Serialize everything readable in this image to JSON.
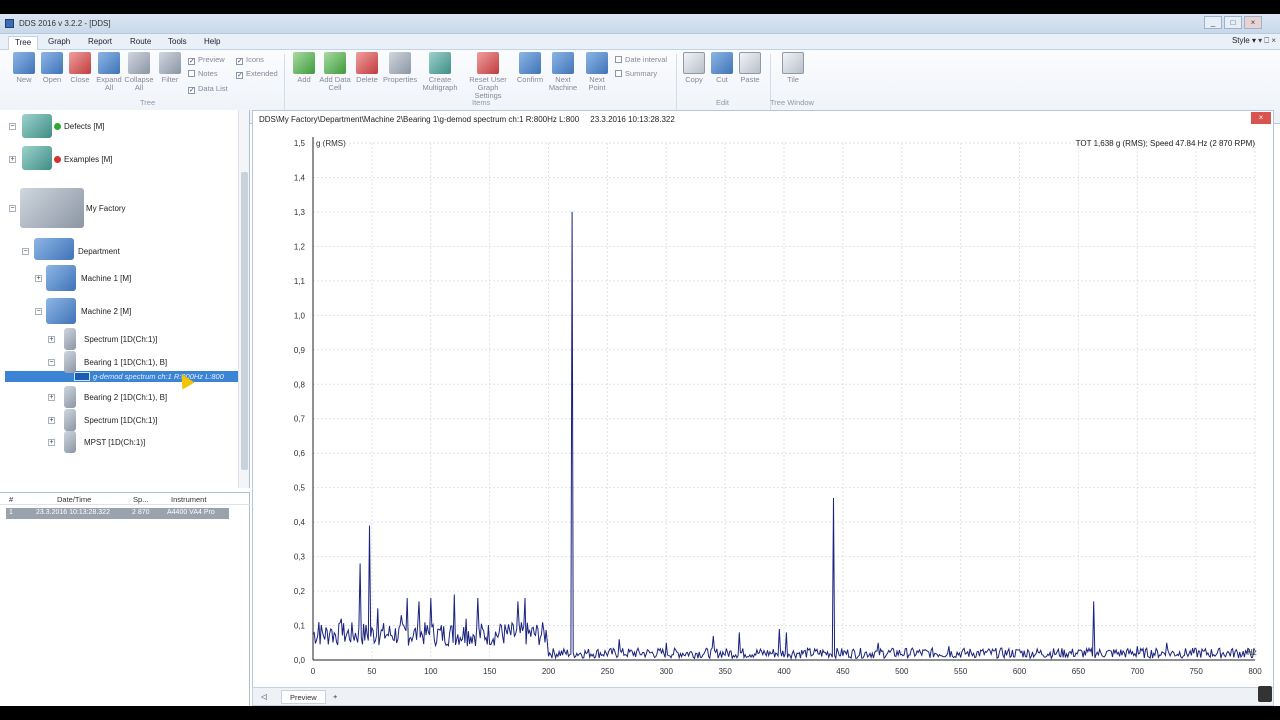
{
  "window": {
    "title": "DDS 2016 v 3.2.2 - [DDS]",
    "controls": [
      "_",
      "□",
      "×"
    ]
  },
  "menu": {
    "tabs": [
      "Tree",
      "Graph",
      "Report",
      "Route",
      "Tools",
      "Help"
    ],
    "active_tab": "Tree",
    "style_label": "Style",
    "ribbon_controls": "▾  ⎕  ×"
  },
  "ribbon": {
    "tree_group": {
      "label": "Tree",
      "buttons": [
        {
          "label": "New",
          "icon": "new-folder-icon"
        },
        {
          "label": "Open",
          "icon": "open-folder-icon"
        },
        {
          "label": "Close",
          "icon": "close-folder-icon"
        },
        {
          "label": "Expand All",
          "icon": "expand-all-icon"
        },
        {
          "label": "Collapse All",
          "icon": "collapse-all-icon"
        },
        {
          "label": "Filter",
          "icon": "filter-icon"
        }
      ],
      "checks": [
        {
          "label": "Preview",
          "checked": true
        },
        {
          "label": "Notes",
          "checked": false
        },
        {
          "label": "Data List",
          "checked": true
        },
        {
          "label": "Icons",
          "checked": true
        },
        {
          "label": "Extended",
          "checked": true
        }
      ]
    },
    "items_group": {
      "label": "Items",
      "buttons": [
        {
          "label": "Add",
          "icon": "add-icon"
        },
        {
          "label": "Add Data Cell",
          "icon": "add-data-cell-icon"
        },
        {
          "label": "Delete",
          "icon": "delete-icon"
        },
        {
          "label": "Properties",
          "icon": "properties-icon"
        },
        {
          "label": "Create Multigraph",
          "icon": "multigraph-icon"
        },
        {
          "label": "Reset User Graph Settings",
          "icon": "reset-settings-icon"
        },
        {
          "label": "Confirm",
          "icon": "confirm-icon"
        },
        {
          "label": "Next Machine",
          "icon": "next-machine-icon"
        },
        {
          "label": "Next Point",
          "icon": "next-point-icon"
        }
      ],
      "checks": [
        {
          "label": "Date interval",
          "checked": false
        },
        {
          "label": "Summary",
          "checked": false
        }
      ]
    },
    "edit_group": {
      "label": "Edit",
      "buttons": [
        {
          "label": "Copy",
          "icon": "copy-icon"
        },
        {
          "label": "Cut",
          "icon": "cut-icon"
        },
        {
          "label": "Paste",
          "icon": "paste-icon"
        }
      ]
    },
    "tree_window_group": {
      "label": "Tree Window",
      "buttons": [
        {
          "label": "Tile",
          "icon": "tile-icon"
        }
      ]
    }
  },
  "tree": {
    "items": [
      {
        "label": "Defects [M]",
        "status": "green"
      },
      {
        "label": "Examples [M]",
        "status": "red"
      },
      {
        "label": "My Factory"
      },
      {
        "label": "Department"
      },
      {
        "label": "Machine 1 [M]"
      },
      {
        "label": "Machine 2 [M]"
      },
      {
        "label": "Spectrum [1D(Ch:1)]"
      },
      {
        "label": "Bearing 1 [1D(Ch:1), B]"
      },
      {
        "label": "g-demod spectrum ch:1 R:800Hz L:800",
        "selected": true
      },
      {
        "label": "Bearing 2 [1D(Ch:1), B]"
      },
      {
        "label": "Spectrum [1D(Ch:1)]"
      },
      {
        "label": "MPST [1D(Ch:1)]"
      }
    ]
  },
  "measurements": {
    "columns": [
      "#",
      "Date/Time",
      "Sp...",
      "Instrument"
    ],
    "rows": [
      {
        "num": "1",
        "datetime": "23.3.2016 10:13:28.322",
        "speed": "2 870",
        "instrument": "A4400 VA4 Pro"
      }
    ]
  },
  "chart_pane": {
    "path": "DDS\\My Factory\\Department\\Machine 2\\Bearing 1\\g-demod spectrum ch:1 R:800Hz L:800",
    "timestamp": "23.3.2016 10:13:28.322",
    "close_label": "×"
  },
  "chart_data": {
    "type": "line",
    "title": "",
    "ylabel": "g (RMS)",
    "xlabel": "Hz",
    "info": "TOT 1,638 g (RMS); Speed 47.84 Hz (2 870 RPM)",
    "xlim": [
      0,
      800
    ],
    "ylim": [
      0,
      1.5
    ],
    "x_ticks": [
      "0",
      "50",
      "100",
      "150",
      "200",
      "250",
      "300",
      "350",
      "400",
      "450",
      "500",
      "550",
      "600",
      "650",
      "700",
      "750",
      "800"
    ],
    "y_ticks": [
      "0,0",
      "0,1",
      "0,2",
      "0,3",
      "0,4",
      "0,5",
      "0,6",
      "0,7",
      "0,8",
      "0,9",
      "1,0",
      "1,1",
      "1,2",
      "1,3",
      "1,4",
      "1,5"
    ],
    "grid": true,
    "series_color": "#1a237e",
    "peaks": [
      {
        "x": 5,
        "y": 0.11
      },
      {
        "x": 15,
        "y": 0.09
      },
      {
        "x": 24,
        "y": 0.12
      },
      {
        "x": 40,
        "y": 0.28
      },
      {
        "x": 48,
        "y": 0.39
      },
      {
        "x": 55,
        "y": 0.15
      },
      {
        "x": 75,
        "y": 0.13
      },
      {
        "x": 80,
        "y": 0.18
      },
      {
        "x": 90,
        "y": 0.17
      },
      {
        "x": 100,
        "y": 0.18
      },
      {
        "x": 120,
        "y": 0.19
      },
      {
        "x": 130,
        "y": 0.12
      },
      {
        "x": 140,
        "y": 0.18
      },
      {
        "x": 160,
        "y": 0.1
      },
      {
        "x": 174,
        "y": 0.17
      },
      {
        "x": 180,
        "y": 0.18
      },
      {
        "x": 220,
        "y": 1.3
      },
      {
        "x": 260,
        "y": 0.06
      },
      {
        "x": 300,
        "y": 0.05
      },
      {
        "x": 340,
        "y": 0.07
      },
      {
        "x": 362,
        "y": 0.08
      },
      {
        "x": 396,
        "y": 0.09
      },
      {
        "x": 402,
        "y": 0.08
      },
      {
        "x": 442,
        "y": 0.47
      },
      {
        "x": 480,
        "y": 0.05
      },
      {
        "x": 540,
        "y": 0.04
      },
      {
        "x": 600,
        "y": 0.03
      },
      {
        "x": 663,
        "y": 0.17
      },
      {
        "x": 700,
        "y": 0.04
      },
      {
        "x": 725,
        "y": 0.05
      },
      {
        "x": 780,
        "y": 0.03
      }
    ]
  },
  "bottom_tabs": {
    "nav_icon": "◁",
    "tabs": [
      "Preview",
      "+"
    ]
  },
  "colors": {
    "selection": "#3b83d4",
    "ribbon_bg": "#edf2f8",
    "close_red": "#d9534f"
  }
}
